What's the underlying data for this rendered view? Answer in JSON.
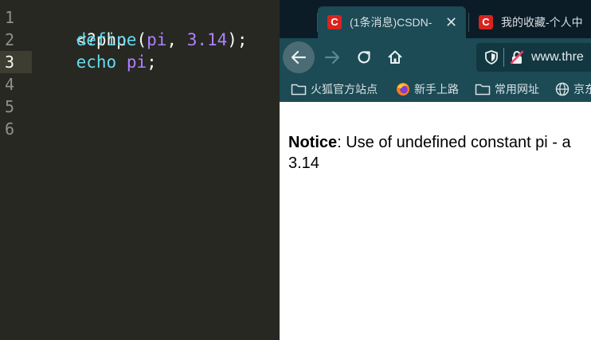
{
  "editor": {
    "line_numbers": [
      "1",
      "2",
      "3",
      "4",
      "5",
      "6"
    ],
    "lines": {
      "l1": "<?php",
      "l2_fn": "define",
      "l2_open": "(",
      "l2_const": "pi",
      "l2_comma": ", ",
      "l2_num": "3.14",
      "l2_close": ");",
      "l3_fn": "echo",
      "l3_const": "pi",
      "l3_end": ";"
    }
  },
  "browser": {
    "tabs": [
      {
        "favicon": "C",
        "title": "(1条消息)CSDN-",
        "close": "✕"
      },
      {
        "favicon": "C",
        "title": "我的收藏-个人中"
      }
    ],
    "url": "www.thre",
    "bookmarks": [
      "火狐官方站点",
      "新手上路",
      "常用网址",
      "京东"
    ],
    "page": {
      "notice_label": "Notice",
      "notice_text": ": Use of undefined constant pi - a",
      "output": "3.14"
    }
  },
  "colors": {
    "editor_bg": "#272822",
    "keyword": "#66d9ef",
    "constant": "#ae81ff",
    "browser_toolbar": "#1c4a55",
    "tabstrip": "#0c1c27"
  }
}
